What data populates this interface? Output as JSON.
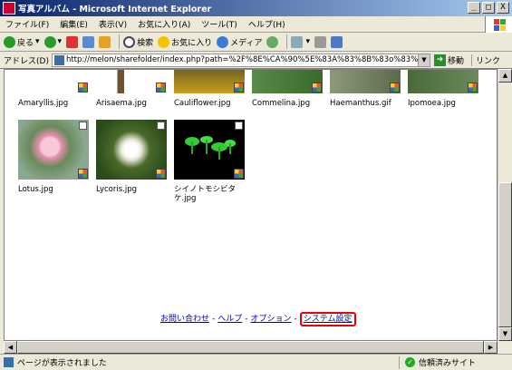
{
  "window": {
    "title": "写真アルバム - Microsoft Internet Explorer",
    "buttons": [
      "_",
      "□",
      "X"
    ]
  },
  "menu": [
    "ファイル(F)",
    "編集(E)",
    "表示(V)",
    "お気に入り(A)",
    "ツール(T)",
    "ヘルプ(H)"
  ],
  "toolbar": {
    "back": "戻る",
    "search": "検索",
    "favorites": "お気に入り",
    "media": "メディア"
  },
  "address": {
    "label": "アドレス(D)",
    "url": "http://melon/sharefolder/index.php?path=%2F%8E%CA%90%5E%83A%83%8B%83o%83%80&dra=&keyword=",
    "go": "移動",
    "links": "リンク"
  },
  "thumbnails_row1": [
    "Amaryllis.jpg",
    "Arisaema.jpg",
    "Cauliflower.jpg",
    "Commelina.jpg",
    "Haemanthus.gif",
    "Ipomoea.jpg"
  ],
  "thumbnails_row2": [
    "Lotus.jpg",
    "Lycoris.jpg",
    "シイノトモシビタケ.jpg"
  ],
  "footer": {
    "contact": "お問い合わせ",
    "help": "ヘルプ",
    "options": "オプション",
    "settings": "システム設定",
    "separator": "-"
  },
  "status": {
    "text": "ページが表示されました",
    "zone": "信頼済みサイト"
  }
}
